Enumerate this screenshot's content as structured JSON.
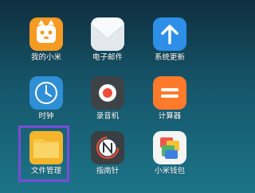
{
  "apps": [
    {
      "label": "我的小米",
      "icon": "mi-bunny-icon",
      "color": "#f59a23"
    },
    {
      "label": "电子邮件",
      "icon": "email-envelope-icon",
      "color": "#eef2f5"
    },
    {
      "label": "系统更新",
      "icon": "update-arrow-icon",
      "color": "#2d8fe8"
    },
    {
      "label": "时钟",
      "icon": "clock-icon",
      "color": "#2f8fd6"
    },
    {
      "label": "录音机",
      "icon": "recorder-icon",
      "color": "#3e4347"
    },
    {
      "label": "计算器",
      "icon": "calculator-icon",
      "color": "#ff7a2b"
    },
    {
      "label": "文件管理",
      "icon": "folder-icon",
      "color": "#f5c23a"
    },
    {
      "label": "指南针",
      "icon": "compass-icon",
      "color": "#3a3f44"
    },
    {
      "label": "小米钱包",
      "icon": "wallet-icon",
      "color": "#f4f4f2"
    }
  ],
  "selection": {
    "app": "文件管理",
    "highlight_color": "#7b4bd6"
  }
}
